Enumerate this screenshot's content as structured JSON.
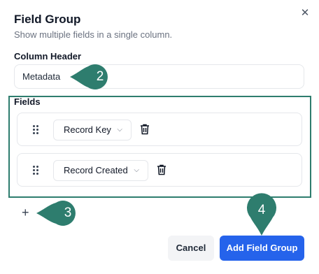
{
  "dialog": {
    "title": "Field Group",
    "subtitle": "Show multiple fields in a single column.",
    "close_icon": "close-icon",
    "column_header_label": "Column Header",
    "column_header_value": "Metadata",
    "fields_label": "Fields",
    "fields": [
      {
        "label": "Record Key"
      },
      {
        "label": "Record Created"
      }
    ],
    "cancel_label": "Cancel",
    "submit_label": "Add Field Group"
  },
  "annotations": {
    "badges": [
      "2",
      "3",
      "4"
    ],
    "badge_color": "#2e7d6e",
    "highlight_color": "#2e7d6e"
  },
  "colors": {
    "primary": "#2563eb",
    "secondary_bg": "#f3f4f6",
    "border": "#e5e7eb"
  }
}
